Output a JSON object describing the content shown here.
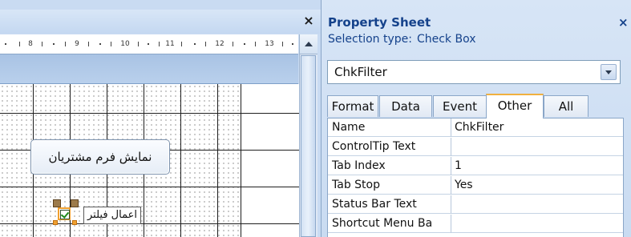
{
  "designer": {
    "close_glyph": "×",
    "ruler_numbers": [
      "8",
      "9",
      "10",
      "11",
      "12",
      "13"
    ],
    "button_label": "نمایش فرم مشتریان",
    "checkbox_label": "اعمال فیلتر",
    "checkbox_checked": true
  },
  "property_sheet": {
    "title": "Property Sheet",
    "close_glyph": "×",
    "selection_type_label": "Selection type:",
    "selection_type_value": "Check Box",
    "object_name": "ChkFilter",
    "tabs": [
      {
        "label": "Format",
        "active": false
      },
      {
        "label": "Data",
        "active": false
      },
      {
        "label": "Event",
        "active": false
      },
      {
        "label": "Other",
        "active": true
      },
      {
        "label": "All",
        "active": false
      }
    ],
    "properties": [
      {
        "name": "Name",
        "value": "ChkFilter"
      },
      {
        "name": "ControlTip Text",
        "value": ""
      },
      {
        "name": "Tab Index",
        "value": "1"
      },
      {
        "name": "Tab Stop",
        "value": "Yes"
      },
      {
        "name": "Status Bar Text",
        "value": ""
      },
      {
        "name": "Shortcut Menu Ba",
        "value": ""
      }
    ]
  },
  "colors": {
    "accent_tab": "#f0b040",
    "title_blue": "#15428b",
    "selection_orange": "#f0a030",
    "checkmark_green": "#1c8a1c"
  }
}
